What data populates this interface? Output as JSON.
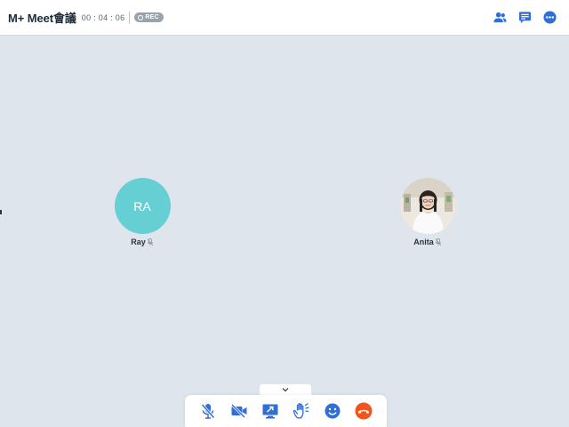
{
  "header": {
    "title": "M+ Meet會議",
    "timer": "00 : 04 : 06",
    "rec_label": "REC",
    "icons": [
      "participants-icon",
      "chat-icon",
      "more-icon"
    ]
  },
  "participants": [
    {
      "name": "Ray",
      "initials": "RA",
      "avatar_color": "#66cfd4",
      "mic": "muted"
    },
    {
      "name": "Anita",
      "initials": "",
      "avatar": "photo",
      "mic": "muted"
    }
  ],
  "toolbar": {
    "buttons": [
      "mic-muted-icon",
      "camera-off-icon",
      "share-screen-icon",
      "raise-hand-icon",
      "emoji-icon",
      "hang-up-icon"
    ]
  },
  "colors": {
    "accent": "#2f6fd6",
    "hangup": "#f2541b",
    "stage": "#dfe5ec"
  }
}
